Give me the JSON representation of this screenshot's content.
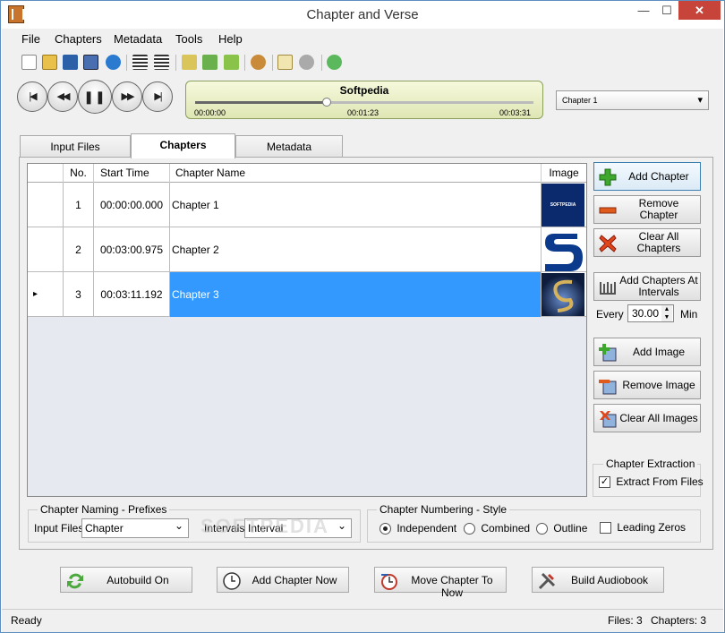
{
  "window": {
    "title": "Chapter and Verse",
    "minimize": "—",
    "maximize": "☐",
    "close": "✕"
  },
  "menu": [
    "File",
    "Chapters",
    "Metadata",
    "Tools",
    "Help"
  ],
  "player": {
    "track_title": "Softpedia",
    "time_start": "00:00:00",
    "time_current": "00:01:23",
    "time_end": "00:03:31",
    "progress": 0.39,
    "chapter_select": "Chapter 1",
    "prev_label": "|◀",
    "rew_label": "◀◀",
    "pause_label": "❚❚",
    "fwd_label": "▶▶",
    "next_label": "▶|"
  },
  "tabs": [
    "Input Files",
    "Chapters",
    "Metadata"
  ],
  "grid": {
    "headers": {
      "no": "No.",
      "start": "Start Time",
      "name": "Chapter Name",
      "image": "Image"
    },
    "rows": [
      {
        "no": "1",
        "start": "00:00:00.000",
        "name": "Chapter 1",
        "marker": ""
      },
      {
        "no": "2",
        "start": "00:03:00.975",
        "name": "Chapter 2",
        "marker": ""
      },
      {
        "no": "3",
        "start": "00:03:11.192",
        "name": "Chapter 3",
        "marker": "▸"
      }
    ],
    "thumb1_text": "SOFTPEDIA"
  },
  "side": {
    "add_chapter": "Add Chapter",
    "remove_chapter": "Remove Chapter",
    "clear_chapters": "Clear All Chapters",
    "add_intervals": "Add Chapters At Intervals",
    "every_label": "Every",
    "every_value": "30.00",
    "min_label": "Min",
    "add_image": "Add Image",
    "remove_image": "Remove Image",
    "clear_images": "Clear All Images",
    "extraction_title": "Chapter Extraction",
    "extract_label": "Extract From Files"
  },
  "naming": {
    "title": "Chapter Naming - Prefixes",
    "input_files_label": "Input Files",
    "input_files_value": "Chapter",
    "intervals_label": "Intervals",
    "intervals_value": "Interval"
  },
  "numbering": {
    "title": "Chapter Numbering - Style",
    "independent": "Independent",
    "combined": "Combined",
    "outline": "Outline",
    "leading_zeros": "Leading Zeros"
  },
  "bottom": {
    "autobuild": "Autobuild On",
    "add_now": "Add Chapter Now",
    "move_now": "Move Chapter To Now",
    "build": "Build Audiobook"
  },
  "status": {
    "text": "Ready",
    "files": "Files: 3",
    "chapters": "Chapters: 3"
  },
  "watermark": "SOFTPEDIA"
}
